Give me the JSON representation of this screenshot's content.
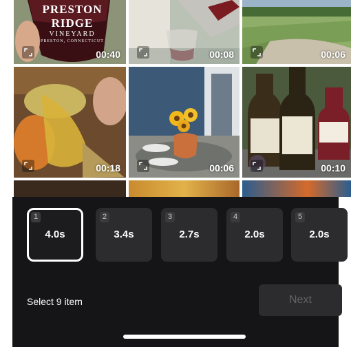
{
  "grid": {
    "thumbnails": [
      {
        "duration": "00:40",
        "logo_text": "PRESTON RIDGE",
        "logo_sub": "VINEYARD",
        "logo_loc": "PRESTON, CONNECTICUT"
      },
      {
        "duration": "00:08"
      },
      {
        "duration": "00:06"
      },
      {
        "duration": "00:18"
      },
      {
        "duration": "00:06"
      },
      {
        "duration": "00:10"
      }
    ]
  },
  "clips": [
    {
      "index": "1",
      "duration": "4.0s",
      "selected": true
    },
    {
      "index": "2",
      "duration": "3.4s",
      "selected": false
    },
    {
      "index": "3",
      "duration": "2.7s",
      "selected": false
    },
    {
      "index": "4",
      "duration": "2.0s",
      "selected": false
    },
    {
      "index": "5",
      "duration": "2.0s",
      "selected": false
    }
  ],
  "footer": {
    "select_text": "Select 9 item",
    "next_label": "Next"
  },
  "colors": {
    "panel_bg": "#151517",
    "clip_bg": "#2c2c2e",
    "next_disabled_text": "#636366"
  }
}
